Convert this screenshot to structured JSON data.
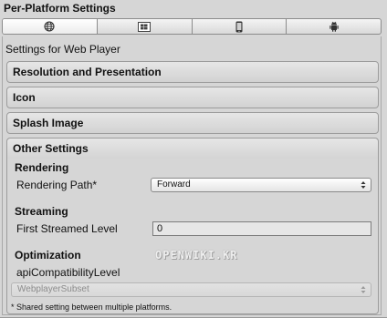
{
  "panel": {
    "title": "Per-Platform Settings"
  },
  "platform_tabs": [
    {
      "icon": "globe-icon",
      "name": "web-player",
      "active": true
    },
    {
      "icon": "windows-icon",
      "name": "standalone",
      "active": false
    },
    {
      "icon": "mobile-phone-icon",
      "name": "ios",
      "active": false
    },
    {
      "icon": "android-icon",
      "name": "android",
      "active": false
    }
  ],
  "settings_for": "Settings for Web Player",
  "sections": {
    "resolution": "Resolution and Presentation",
    "icon": "Icon",
    "splash": "Splash Image",
    "other": "Other Settings"
  },
  "rendering": {
    "heading": "Rendering",
    "path_label": "Rendering Path*",
    "path_value": "Forward"
  },
  "streaming": {
    "heading": "Streaming",
    "first_level_label": "First Streamed Level",
    "first_level_value": "0"
  },
  "optimization": {
    "heading": "Optimization",
    "api_label": "apiCompatibilityLevel",
    "api_value": "WebplayerSubset"
  },
  "footnote": "* Shared setting between multiple platforms.",
  "watermark": "OPENWIKI.KR",
  "colors": {
    "panel_bg": "#d6d6d6",
    "border": "#9c9c9c",
    "disabled_text": "#8c8c8c"
  }
}
